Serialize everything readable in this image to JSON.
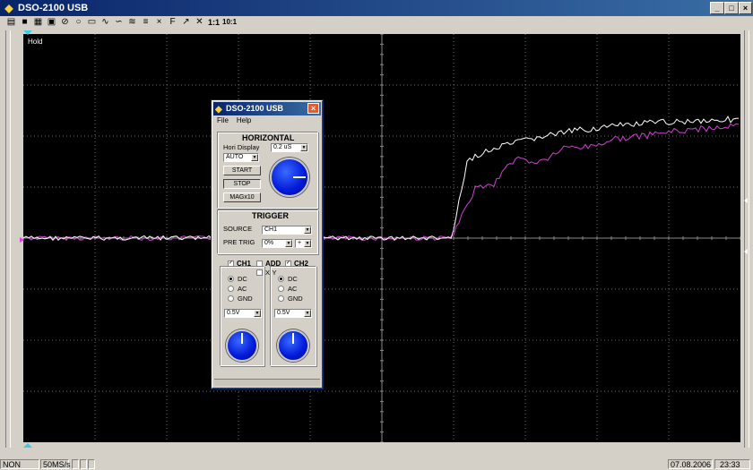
{
  "window": {
    "title": "DSO-2100 USB"
  },
  "screen": {
    "hold_label": "Hold",
    "colors": {
      "ch1": "#ffffff",
      "ch2": "#d040d0",
      "grid": "#6a6a6a",
      "background": "#000000"
    }
  },
  "status": {
    "trigger": "NON TRIG",
    "sample_rate": "50MS/s",
    "date": "07.08.2006",
    "time": "23:33"
  },
  "dialog": {
    "title": "DSO-2100 USB",
    "menu": {
      "file": "File",
      "help": "Help"
    },
    "horizontal": {
      "heading": "HORIZONTAL",
      "hori_display_label": "Hori Display",
      "timebase": "0.2 uS",
      "mode": "AUTO",
      "start_label": "START",
      "stop_label": "STOP",
      "mag_label": "MAGx10"
    },
    "trigger": {
      "heading": "TRIGGER",
      "source_label": "SOURCE",
      "source_value": "CH1",
      "pretrig_label": "PRE TRIG",
      "pretrig_value": "0%",
      "slope_value": "+"
    },
    "channels": {
      "ch1_label": "CH1",
      "add_label": "ADD",
      "xy_label": "X-Y",
      "ch2_label": "CH2",
      "dc_label": "DC",
      "ac_label": "AC",
      "gnd_label": "GND",
      "ch1_volts": "0.5V",
      "ch2_volts": "0.5V"
    }
  }
}
